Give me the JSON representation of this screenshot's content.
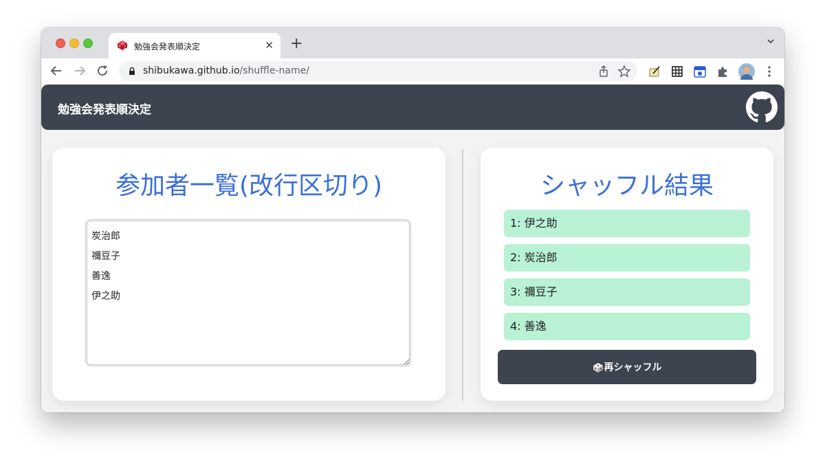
{
  "browser": {
    "tab_title": "勉強会発表順決定",
    "url_host": "shibukawa.github.io",
    "url_path": "/shuffle-name/",
    "new_tab_label": "+",
    "close_label": "✕"
  },
  "app": {
    "title": "勉強会発表順決定"
  },
  "left_panel": {
    "heading": "参加者一覧(改行区切り)",
    "participants_text": "炭治郎\n禰豆子\n善逸\n伊之助"
  },
  "right_panel": {
    "heading": "シャッフル結果",
    "results": [
      "1: 伊之助",
      "2: 炭治郎",
      "3: 禰豆子",
      "4: 善逸"
    ],
    "reshuffle_label": "再シャッフル"
  },
  "colors": {
    "header_bg": "#3e4350",
    "heading_blue": "#3b6fd9",
    "result_bg": "#b9f1d4"
  }
}
